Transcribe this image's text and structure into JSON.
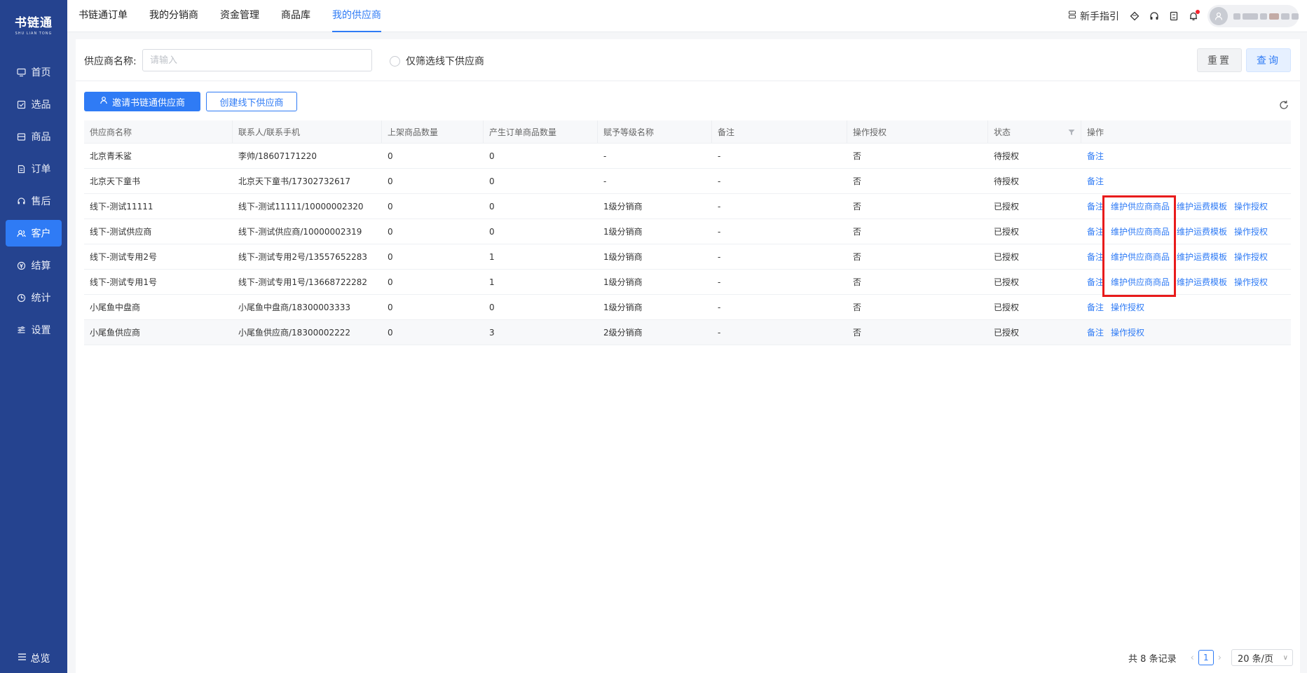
{
  "sidebar": {
    "logo_main": "书链通",
    "logo_sub": "SHU LIAN TONG",
    "items": [
      {
        "label": "首页",
        "icon": "monitor-icon"
      },
      {
        "label": "选品",
        "icon": "checkbox-icon"
      },
      {
        "label": "商品",
        "icon": "box-icon"
      },
      {
        "label": "订单",
        "icon": "document-icon"
      },
      {
        "label": "售后",
        "icon": "headset-icon"
      },
      {
        "label": "客户",
        "icon": "users-icon"
      },
      {
        "label": "结算",
        "icon": "settle-icon"
      },
      {
        "label": "统计",
        "icon": "clock-chart-icon"
      },
      {
        "label": "设置",
        "icon": "sliders-icon"
      }
    ],
    "active_item": "客户",
    "footer_label": "总览"
  },
  "topbar": {
    "tabs": [
      "书链通订单",
      "我的分销商",
      "资金管理",
      "商品库",
      "我的供应商"
    ],
    "active_tab": "我的供应商",
    "guide_label": "新手指引"
  },
  "filter": {
    "supplier_label": "供应商名称:",
    "supplier_placeholder": "请输入",
    "offline_only_label": "仅筛选线下供应商",
    "reset_label": "重置",
    "query_label": "查询"
  },
  "actions": {
    "invite_label": "邀请书链通供应商",
    "create_label": "创建线下供应商"
  },
  "table": {
    "headers": [
      "供应商名称",
      "联系人/联系手机",
      "上架商品数量",
      "产生订单商品数量",
      "赋予等级名称",
      "备注",
      "操作授权",
      "状态",
      "操作"
    ],
    "rows": [
      {
        "name": "北京青禾鲨",
        "contact": "李帅/18607171220",
        "listed": "0",
        "ordered": "0",
        "level": "-",
        "remark": "-",
        "auth": "否",
        "status": "待授权",
        "ops": [
          "备注"
        ]
      },
      {
        "name": "北京天下童书",
        "contact": "北京天下童书/17302732617",
        "listed": "0",
        "ordered": "0",
        "level": "-",
        "remark": "-",
        "auth": "否",
        "status": "待授权",
        "ops": [
          "备注"
        ]
      },
      {
        "name": "线下-测试11111",
        "contact": "线下-测试11111/10000002320",
        "listed": "0",
        "ordered": "0",
        "level": "1级分销商",
        "remark": "-",
        "auth": "否",
        "status": "已授权",
        "ops": [
          "备注",
          "维护供应商商品",
          "维护运费模板",
          "操作授权"
        ]
      },
      {
        "name": "线下-测试供应商",
        "contact": "线下-测试供应商/10000002319",
        "listed": "0",
        "ordered": "0",
        "level": "1级分销商",
        "remark": "-",
        "auth": "否",
        "status": "已授权",
        "ops": [
          "备注",
          "维护供应商商品",
          "维护运费模板",
          "操作授权"
        ]
      },
      {
        "name": "线下-测试专用2号",
        "contact": "线下-测试专用2号/13557652283",
        "listed": "0",
        "ordered": "1",
        "level": "1级分销商",
        "remark": "-",
        "auth": "否",
        "status": "已授权",
        "ops": [
          "备注",
          "维护供应商商品",
          "维护运费模板",
          "操作授权"
        ]
      },
      {
        "name": "线下-测试专用1号",
        "contact": "线下-测试专用1号/13668722282",
        "listed": "0",
        "ordered": "1",
        "level": "1级分销商",
        "remark": "-",
        "auth": "否",
        "status": "已授权",
        "ops": [
          "备注",
          "维护供应商商品",
          "维护运费模板",
          "操作授权"
        ]
      },
      {
        "name": "小尾鱼中盘商",
        "contact": "小尾鱼中盘商/18300003333",
        "listed": "0",
        "ordered": "0",
        "level": "1级分销商",
        "remark": "-",
        "auth": "否",
        "status": "已授权",
        "ops": [
          "备注",
          "操作授权"
        ]
      },
      {
        "name": "小尾鱼供应商",
        "contact": "小尾鱼供应商/18300002222",
        "listed": "0",
        "ordered": "3",
        "level": "2级分销商",
        "remark": "-",
        "auth": "否",
        "status": "已授权",
        "ops": [
          "备注",
          "操作授权"
        ]
      }
    ]
  },
  "pagination": {
    "total_label": "共 8 条记录",
    "current_page": "1",
    "page_size_label": "20 条/页"
  },
  "colors": {
    "sidebar_bg": "#25438f",
    "accent": "#2f7bf5",
    "highlight_border": "#e81b1b"
  }
}
